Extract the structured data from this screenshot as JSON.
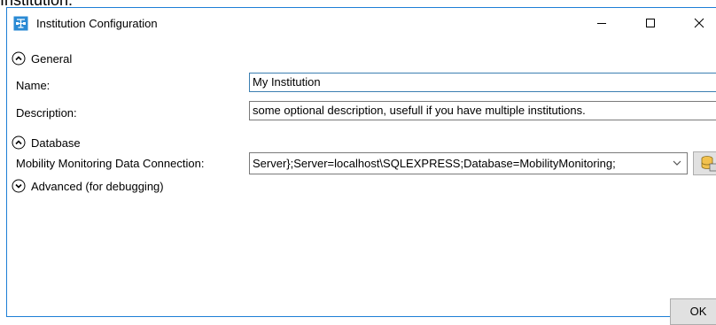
{
  "page_caption": "Institution.",
  "window": {
    "title": "Institution Configuration",
    "controls": {
      "minimize": "—",
      "maximize": "☐",
      "close": "✕"
    }
  },
  "sections": {
    "general": {
      "label": "General",
      "expanded": true
    },
    "database": {
      "label": "Database",
      "expanded": true
    },
    "advanced": {
      "label": "Advanced (for debugging)",
      "expanded": false
    }
  },
  "fields": {
    "name": {
      "label": "Name:",
      "value": "My Institution"
    },
    "description": {
      "label": "Description:",
      "value": "some optional description, usefull if you have multiple institutions."
    },
    "connection": {
      "label": "Mobility Monitoring Data Connection:",
      "value": "Server};Server=localhost\\SQLEXPRESS;Database=MobilityMonitoring;"
    }
  },
  "buttons": {
    "ok": "OK"
  },
  "colors": {
    "window_border": "#1e7fd6",
    "icon_blue": "#2a8ad4",
    "focus_border": "#3c7fb1"
  },
  "icons": {
    "app": "app-config-icon",
    "db_button": "database-browse-icon"
  }
}
